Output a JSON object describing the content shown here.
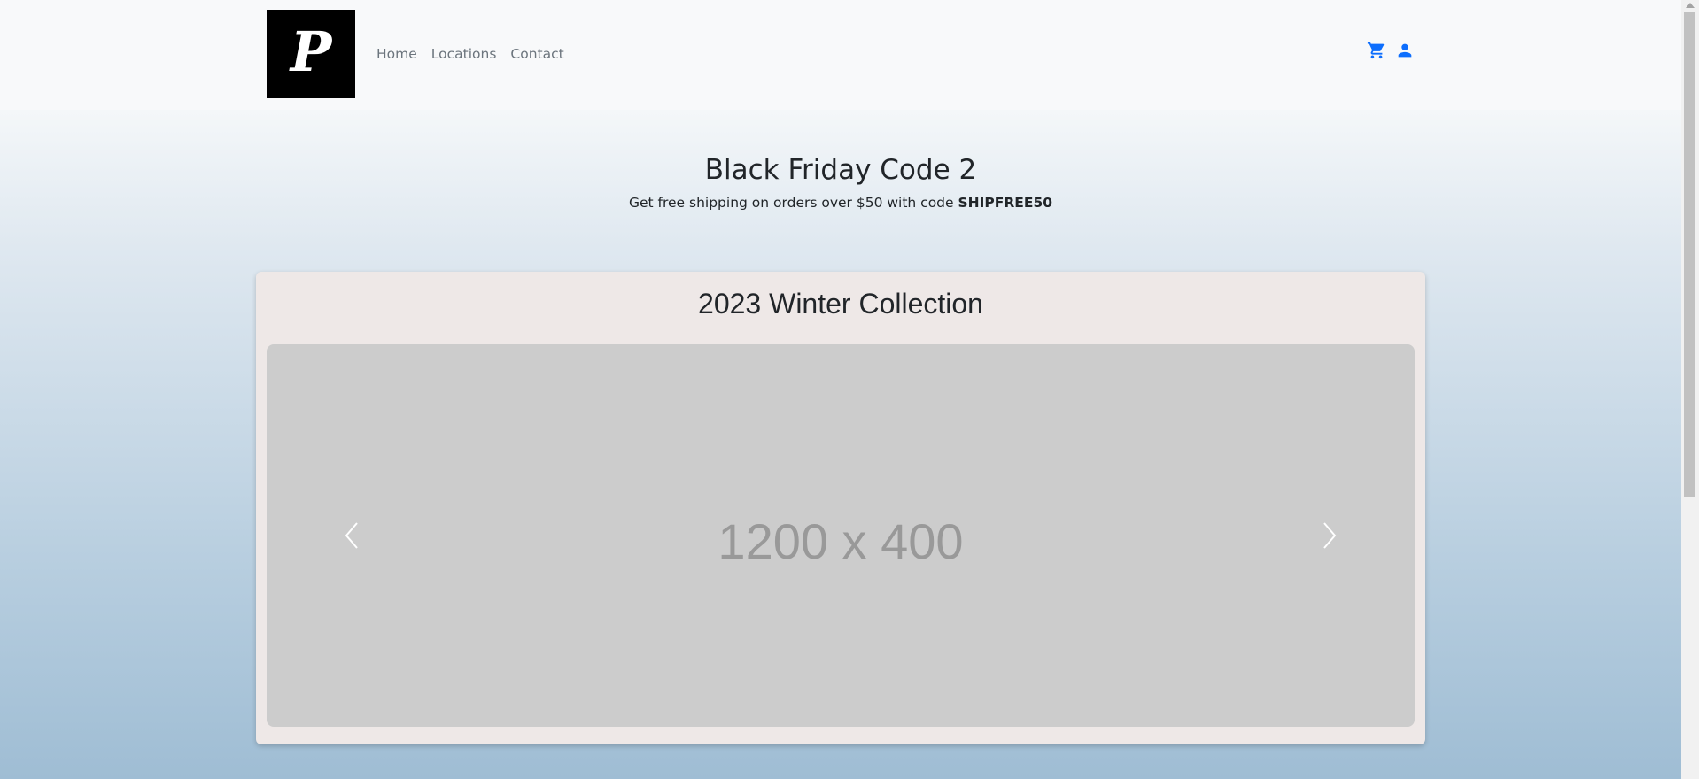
{
  "navbar": {
    "logo_letter": "P",
    "links": [
      "Home",
      "Locations",
      "Contact"
    ],
    "icons": [
      "cart-icon",
      "user-icon"
    ],
    "accent_color": "#0d6efd"
  },
  "promo": {
    "title": "Black Friday Code 2",
    "text_before": "Get free shipping on orders over $50 with code ",
    "code": "SHIPFREE50"
  },
  "collection": {
    "title": "2023 Winter Collection",
    "slide_label": "1200 x 400",
    "prev_icon": "chevron-left-icon",
    "next_icon": "chevron-right-icon"
  }
}
